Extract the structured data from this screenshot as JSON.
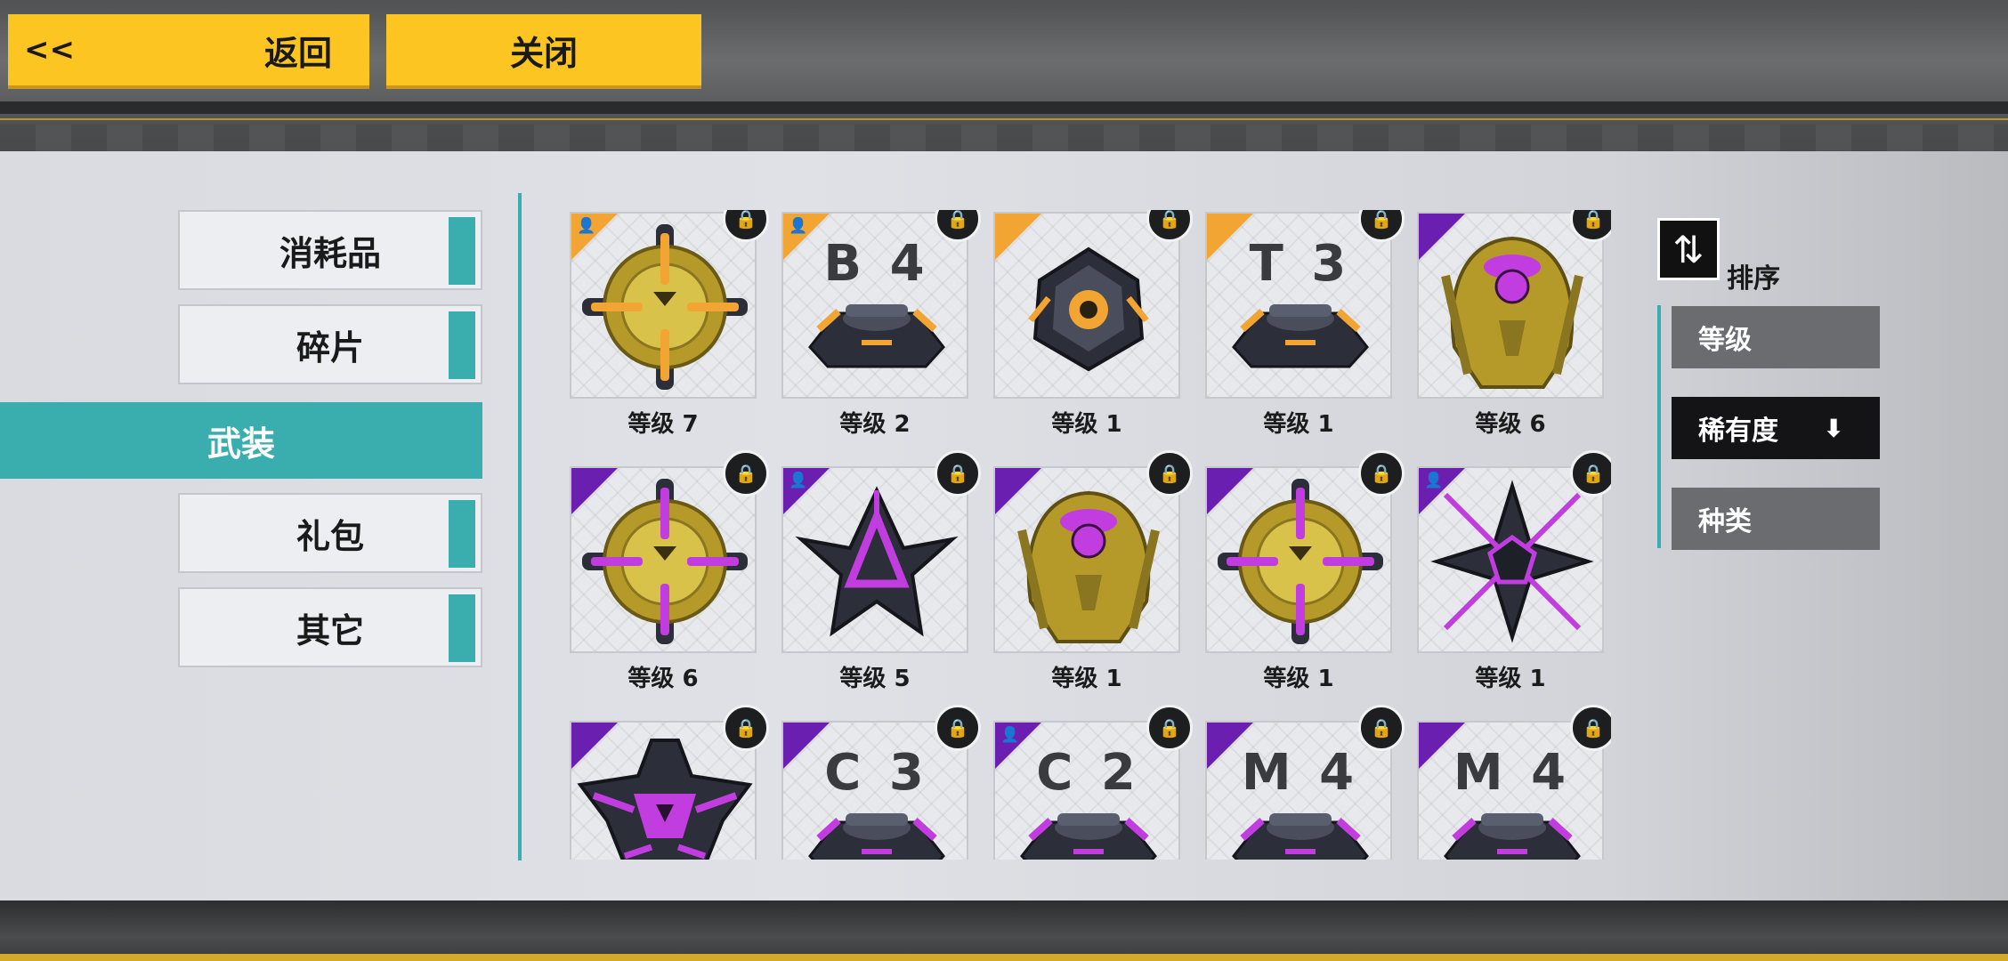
{
  "header": {
    "back_arrows": "<<",
    "back_label": "返回",
    "close_label": "关闭"
  },
  "categories": [
    {
      "label": "消耗品",
      "active": false
    },
    {
      "label": "碎片",
      "active": false
    },
    {
      "label": "武装",
      "active": true
    },
    {
      "label": "礼包",
      "active": false
    },
    {
      "label": "其它",
      "active": false
    }
  ],
  "items": [
    {
      "level": "等级 7",
      "rarity": "orange",
      "person": true,
      "art": "orb-gold-orange",
      "code": ""
    },
    {
      "level": "等级 2",
      "rarity": "orange",
      "person": true,
      "art": "base-orange",
      "code": "B 4"
    },
    {
      "level": "等级 1",
      "rarity": "orange",
      "person": false,
      "art": "core-dark-orange",
      "code": ""
    },
    {
      "level": "等级 1",
      "rarity": "orange",
      "person": false,
      "art": "base-orange",
      "code": "T 3"
    },
    {
      "level": "等级 6",
      "rarity": "purple",
      "person": false,
      "art": "shell-gold-purple",
      "code": ""
    },
    {
      "level": "等级 6",
      "rarity": "purple",
      "person": false,
      "art": "orb-gold-purple",
      "code": ""
    },
    {
      "level": "等级 5",
      "rarity": "purple",
      "person": true,
      "art": "star-dark-purple",
      "code": ""
    },
    {
      "level": "等级 1",
      "rarity": "purple",
      "person": false,
      "art": "shell-gold-purple",
      "code": ""
    },
    {
      "level": "等级 1",
      "rarity": "purple",
      "person": false,
      "art": "orb-gold-purple",
      "code": ""
    },
    {
      "level": "等级 1",
      "rarity": "purple",
      "person": true,
      "art": "shuriken-purple",
      "code": ""
    },
    {
      "level": "",
      "rarity": "purple",
      "person": false,
      "art": "mask-purple",
      "code": ""
    },
    {
      "level": "",
      "rarity": "purple",
      "person": false,
      "art": "base-purple",
      "code": "C 3"
    },
    {
      "level": "",
      "rarity": "purple",
      "person": true,
      "art": "base-purple",
      "code": "C 2"
    },
    {
      "level": "",
      "rarity": "purple",
      "person": false,
      "art": "base-purple",
      "code": "M 4"
    },
    {
      "level": "",
      "rarity": "purple",
      "person": false,
      "art": "base-purple",
      "code": "M 4"
    }
  ],
  "sort": {
    "icon": "sort-swap-icon",
    "label": "排序",
    "options": [
      {
        "label": "等级",
        "active": false,
        "arrow": ""
      },
      {
        "label": "稀有度",
        "active": true,
        "arrow": "⬇"
      },
      {
        "label": "种类",
        "active": false,
        "arrow": ""
      }
    ]
  },
  "colors": {
    "accent_teal": "#3aaeae",
    "button_yellow": "#fdc521",
    "rarity_orange": "#f3a534",
    "rarity_purple": "#6b1fb1",
    "lock": "#1d1e20"
  }
}
